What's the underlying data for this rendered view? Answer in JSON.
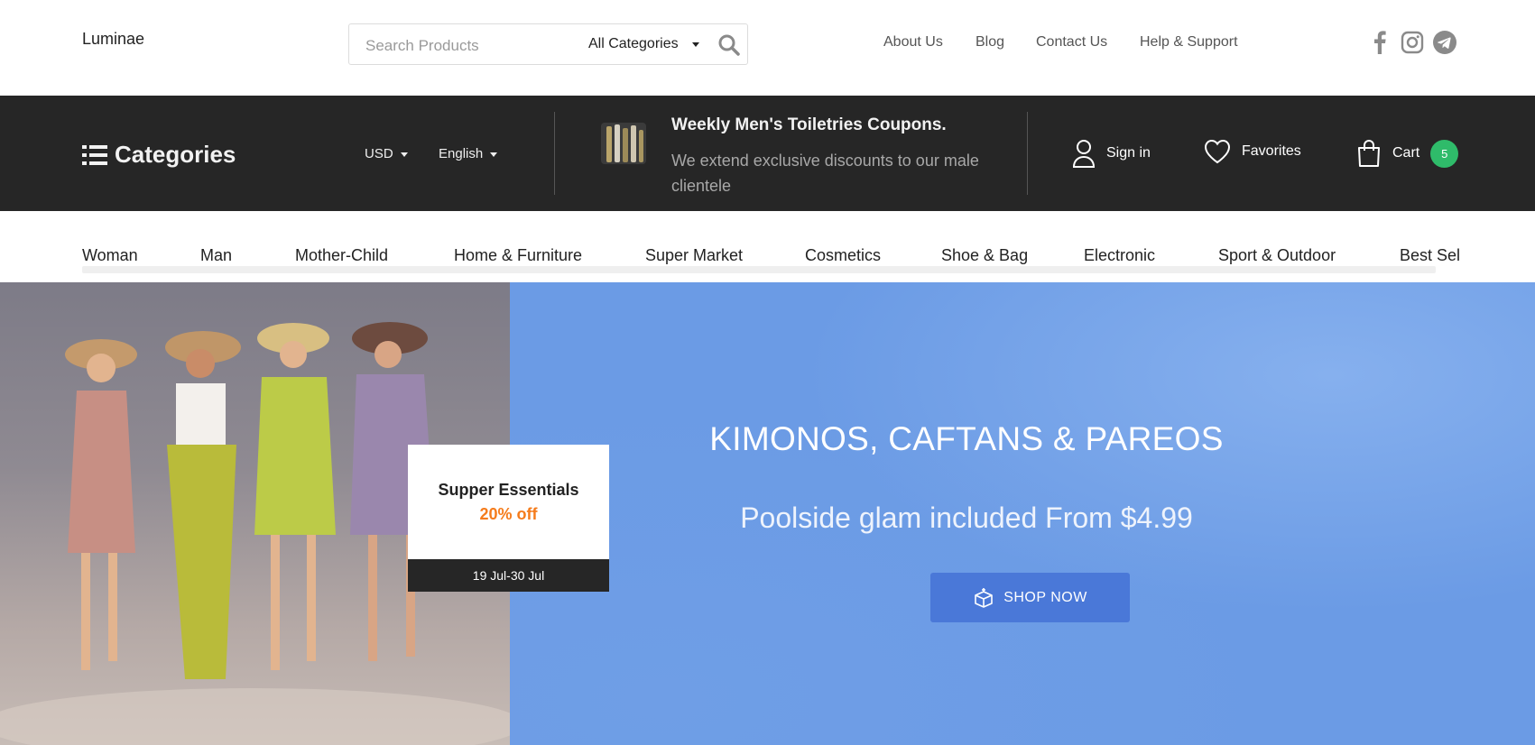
{
  "header": {
    "logo": "Luminae",
    "search": {
      "placeholder": "Search Products",
      "category": "All Categories"
    },
    "links": [
      "About Us",
      "Blog",
      "Contact Us",
      "Help & Support"
    ],
    "social_icons": [
      "facebook-icon",
      "instagram-icon",
      "telegram-icon"
    ]
  },
  "darkbar": {
    "categories_label": "Categories",
    "currency": "USD",
    "language": "English",
    "promo": {
      "title": "Weekly Men's Toiletries Coupons.",
      "text": "We extend exclusive discounts to our male clientele"
    },
    "account": {
      "sign_in": "Sign in",
      "favorites": "Favorites",
      "cart": "Cart",
      "cart_count": "5"
    }
  },
  "nav": {
    "items": [
      "Woman",
      "Man",
      "Mother-Child",
      "Home & Furniture",
      "Super Market",
      "Cosmetics",
      "Shoe & Bag",
      "Electronic",
      "Sport & Outdoor",
      "Best Sel"
    ]
  },
  "hero": {
    "offer": {
      "title": "Supper Essentials",
      "discount": "20% off",
      "dates": "19 Jul-30 Jul"
    },
    "title": "KIMONOS, CAFTANS & PAREOS",
    "subtitle": "Poolside glam included From $4.99",
    "button": "SHOP NOW"
  },
  "colors": {
    "dark": "#262626",
    "accent_orange": "#f57c1c",
    "badge_green": "#2fbb6a",
    "hero_blue": "#6b9be5",
    "button_blue": "#4a78d8"
  }
}
